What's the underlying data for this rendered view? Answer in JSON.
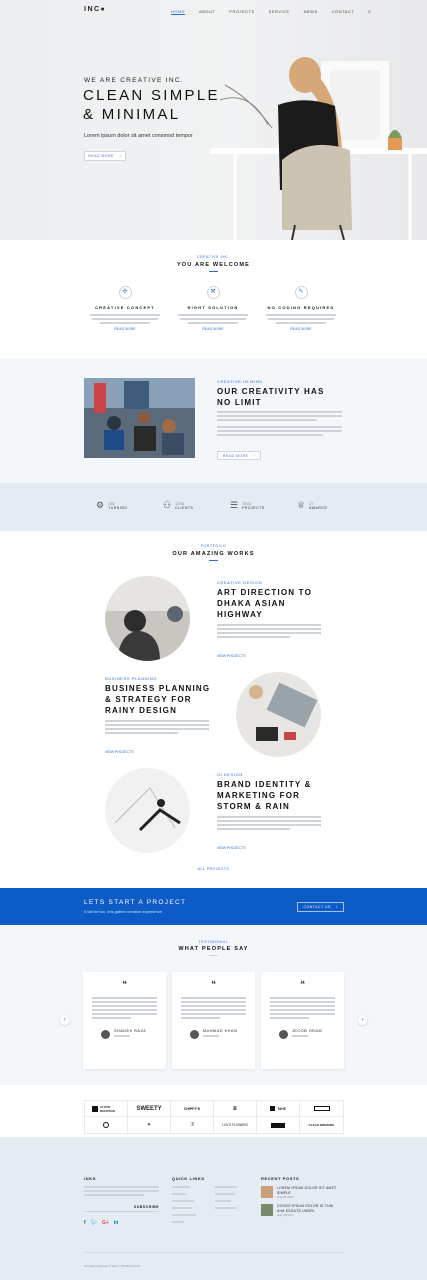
{
  "brand": "INC●",
  "nav": [
    "HOME",
    "ABOUT",
    "PROJECTS",
    "SERVICE",
    "NEWS",
    "CONTACT"
  ],
  "hero": {
    "kicker": "WE ARE CREATIVE INC.",
    "title1": "CLEAN SIMPLE",
    "title2": "& MINIMAL",
    "sub": "Lorem ipsum dolor sit amet consmod tempor",
    "btn": "READ MORE"
  },
  "welcome": {
    "kicker": "CREATIVE INC.",
    "title": "YOU ARE WELCOME",
    "items": [
      {
        "t": "CREATIVE CONCEPT",
        "m": "READ MORE"
      },
      {
        "t": "RIGHT SOLUTION",
        "m": "READ MORE"
      },
      {
        "t": "NO CODING REQUIRED",
        "m": "READ MORE"
      }
    ]
  },
  "mind": {
    "kicker": "CREATIVE IN MIND",
    "title1": "OUR CREATIVITY HAS",
    "title2": "NO LIMIT",
    "btn": "READ MORE"
  },
  "stats": [
    {
      "n": "256",
      "l": "TURNING"
    },
    {
      "n": "1236",
      "l": "CLIENTS"
    },
    {
      "n": "7503",
      "l": "PROJECTS"
    },
    {
      "n": "27",
      "l": "AWARDS"
    }
  ],
  "works": {
    "kicker": "PORTFOLIO",
    "title": "OUR AMAZING WORKS",
    "items": [
      {
        "k": "CREATIVE DESIGN",
        "t": [
          "ART DIRECTION TO",
          "DHAKA ASIAN",
          "HIGHWAY"
        ],
        "m": "VIEW PROJECTS"
      },
      {
        "k": "BUSINESS PLANNING",
        "t": [
          "BUSINESS PLANNING",
          "& STRATEGY FOR",
          "RAINY DESIGN"
        ],
        "m": "VIEW PROJECTS"
      },
      {
        "k": "UI DESIGN",
        "t": [
          "BRAND IDENTITY &",
          "MARKETING FOR",
          "STORM & RAIN"
        ],
        "m": "VIEW PROJECTS"
      }
    ],
    "all": "ALL PROJECTS"
  },
  "cta": {
    "title": "LETS START A PROJECT",
    "sub": "It will be fun, lets gather creative experience",
    "btn": "CONTACT US"
  },
  "testi": {
    "kicker": "TESTIMONIAL",
    "title": "WHAT PEOPLE SAY",
    "people": [
      {
        "n": "SHADEK RAZA"
      },
      {
        "n": "MAHMUD KHAN"
      },
      {
        "n": "JECOB ORAM"
      }
    ]
  },
  "logos": [
    "CLOUD MOUNTAIN",
    "SWEETY",
    "CHIPPY'S",
    "",
    "TAHE",
    "",
    "",
    "",
    "",
    "LUV'S FLOWERS",
    "",
    "CLEAR BREWING"
  ],
  "footer": {
    "col1": "INKS",
    "col2": "QUICK LINKS",
    "col3": "RECENT POSTS",
    "subscribe": "SUBSCRIBE",
    "posts": [
      {
        "t": "LOREM IPSUM DOLOR SIT AMET SIMPLE",
        "d": "Aug 28 2017"
      },
      {
        "t": "OCHOO IPSUM DOLOR ID TUNI AHA ESOUTE UNDRI",
        "d": "Aug 28 2017"
      }
    ],
    "copy": "All rights reserved © 2017  ITOXBA 5 ID.IN"
  }
}
